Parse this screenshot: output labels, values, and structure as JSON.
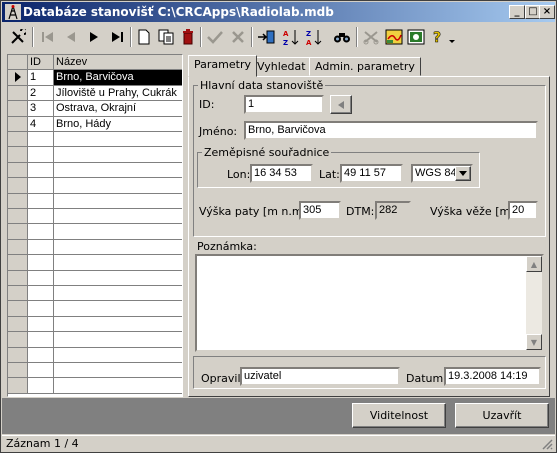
{
  "window": {
    "title": "Databáze stanovišť C:\\CRCApps\\Radiolab.mdb"
  },
  "caption_buttons": {
    "minimize": "_",
    "maximize": "□",
    "close": "×"
  },
  "toolbar": {
    "buttons": [
      "tools-icon",
      "first-record-icon",
      "prev-record-icon",
      "next-record-icon",
      "last-record-icon",
      "new-record-icon",
      "copy-record-icon",
      "delete-record-icon",
      "confirm-icon",
      "cancel-icon",
      "import-icon",
      "sort-ascending-icon",
      "sort-descending-icon",
      "find-icon",
      "cut-icon",
      "map-icon",
      "picture-icon",
      "help-icon",
      "overflow-icon"
    ]
  },
  "grid": {
    "columns": [
      "ID",
      "Název"
    ],
    "rows": [
      {
        "id": "1",
        "name": "Brno, Barvičova",
        "selected": true
      },
      {
        "id": "2",
        "name": "Jíloviště u Prahy, Cukrák"
      },
      {
        "id": "3",
        "name": "Ostrava, Okrajní"
      },
      {
        "id": "4",
        "name": "Brno, Hády"
      }
    ],
    "empty_rows": 17
  },
  "tabs": [
    {
      "label": "Parametry",
      "active": true
    },
    {
      "label": "Vyhledat"
    },
    {
      "label": "Admin. parametry"
    }
  ],
  "main": {
    "group_title": "Hlavní data stanoviště",
    "id_label": "ID:",
    "id_value": "1",
    "name_label": "Jméno:",
    "name_value": "Brno, Barvičova",
    "geo_title": "Zeměpisné souřadnice",
    "lon_label": "Lon:",
    "lon_value": "16 34 53",
    "lat_label": "Lat:",
    "lat_value": "49 11 57",
    "datum_select": "WGS 84",
    "height_label": "Výška paty [m n.m.]:",
    "height_value": "305",
    "dtm_label": "DTM:",
    "dtm_value": "282",
    "tower_label": "Výška věže [m]:",
    "tower_value": "20",
    "note_label": "Poznámka:",
    "note_value": "",
    "editor_label": "Opravil:",
    "editor_value": "uzivatel",
    "date_label": "Datum:",
    "date_value": "19.3.2008 14:19"
  },
  "buttons": {
    "visibility": "Viditelnost",
    "close": "Uzavřít"
  },
  "status": {
    "text": "Záznam 1 / 4"
  },
  "colors": {
    "title_start": "#0a246a",
    "title_end": "#a6caf0",
    "face": "#d4d0c8"
  }
}
